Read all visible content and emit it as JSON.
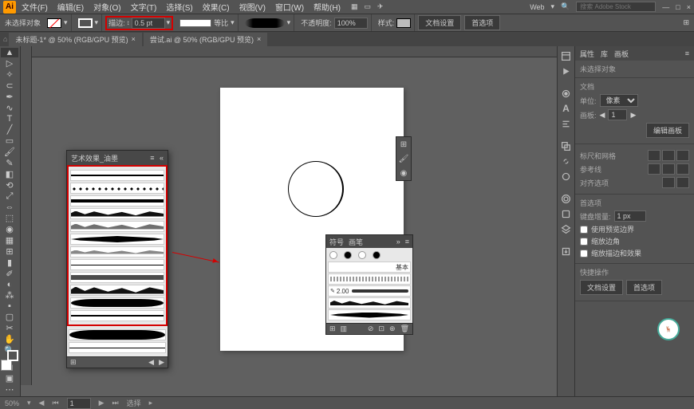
{
  "menubar": {
    "items": [
      "文件(F)",
      "编辑(E)",
      "对象(O)",
      "文字(T)",
      "选择(S)",
      "效果(C)",
      "视图(V)",
      "窗口(W)",
      "帮助(H)"
    ],
    "search_placeholder": "搜索 Adobe Stock",
    "layout_label": "Web"
  },
  "ctrlbar": {
    "noselect": "未选择对象",
    "stroke_label": "描边:",
    "stroke_value": "0.5 pt",
    "uniform": "等比",
    "opacity_label": "不透明度:",
    "opacity_value": "100%",
    "style": "样式:",
    "docsetup": "文档设置",
    "prefs": "首选项"
  },
  "tabs": [
    {
      "label": "未标题-1* @ 50% (RGB/GPU 预览)"
    },
    {
      "label": "尝试.ai @ 50% (RGB/GPU 预览)"
    }
  ],
  "brush_panel": {
    "title": "艺术效果_油墨"
  },
  "brushes": {
    "tab1": "符号",
    "tab2": "画笔",
    "basic": "基本",
    "width_val": "2.00"
  },
  "right": {
    "tabs": [
      "属性",
      "库",
      "画板"
    ],
    "noselection": "未选择对象",
    "doc": "文档",
    "units": "单位:",
    "units_val": "像素",
    "artboard": "画板:",
    "edit_artboard": "编辑画板",
    "ruler_grid": "标尺和网格",
    "guides": "参考线",
    "align_opts": "对齐选项",
    "prefs": "首选项",
    "key_inc": "键盘增量:",
    "key_val": "1 px",
    "cb1": "使用预览边界",
    "cb2": "缩放边角",
    "cb3": "缩放描边和效果",
    "quick": "快捷操作",
    "docsetup": "文档设置",
    "prefs_btn": "首选项"
  },
  "status": {
    "zoom": "50%",
    "tool": "选择"
  },
  "icons": {
    "close": "×",
    "min": "—",
    "max": "□",
    "menu": "≡",
    "chev": "▾",
    "arrow": "▸"
  }
}
